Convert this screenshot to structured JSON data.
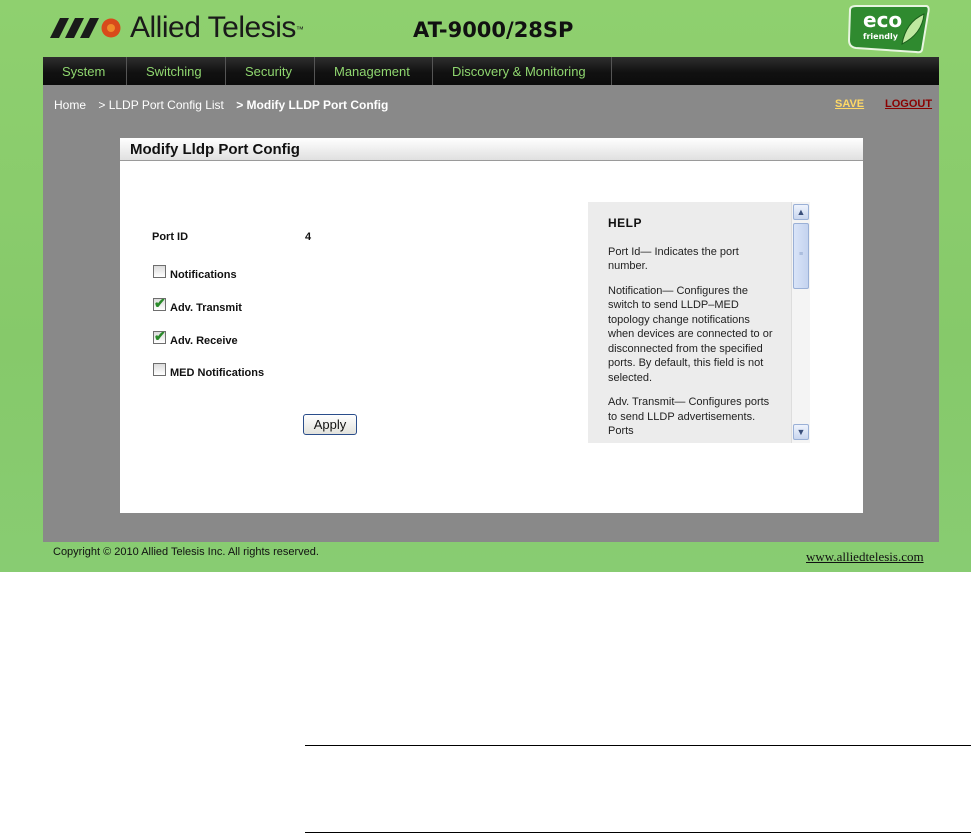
{
  "header": {
    "brand": "Allied Telesis",
    "trademark": "™",
    "model": "AT-9000/28SP",
    "eco_badge": {
      "line1": "eco",
      "line2": "friendly"
    }
  },
  "nav": [
    "System",
    "Switching",
    "Security",
    "Management",
    "Discovery & Monitoring"
  ],
  "breadcrumb": {
    "home": "Home",
    "list": "> LLDP Port Config List",
    "current": "> Modify LLDP Port Config"
  },
  "actions": {
    "save": "SAVE",
    "logout": "LOGOUT"
  },
  "panel": {
    "title": "Modify Lldp Port Config",
    "port_id_label": "Port ID",
    "port_id_value": "4",
    "checkboxes": [
      {
        "label": "Notifications",
        "checked": false
      },
      {
        "label": "Adv. Transmit",
        "checked": true
      },
      {
        "label": "Adv. Receive",
        "checked": true
      },
      {
        "label": "MED Notifications",
        "checked": false
      }
    ],
    "apply_label": "Apply"
  },
  "help": {
    "title": "HELP",
    "paragraphs": [
      "Port Id— Indicates the port number.",
      "Notification— Configures the switch to send LLDP–MED topology change notifications when devices are connected to or disconnected from the specified ports. By default, this field is not selected.",
      "Adv. Transmit— Configures ports to send LLDP advertisements. Ports"
    ]
  },
  "footer": {
    "copyright": "Copyright © 2010 Allied Telesis Inc. All rights reserved.",
    "site": "www.alliedtelesis.com"
  },
  "colors": {
    "page_green": "#88cc6e",
    "nav_text": "#8fd66f",
    "save": "#ffd966",
    "logout": "#8b0000",
    "content_gray": "#898989"
  }
}
